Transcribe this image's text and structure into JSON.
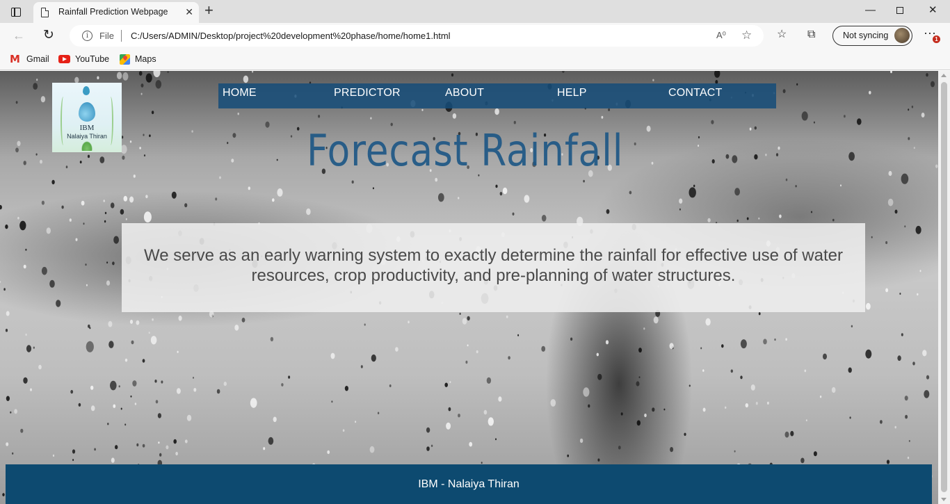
{
  "browser": {
    "tab_title": "Rainfall Prediction Webpage",
    "tab_close": "✕",
    "new_tab": "+",
    "scheme": "File",
    "url": "C:/Users/ADMIN/Desktop/project%20development%20phase/home/home1.html",
    "read_aloud": "A⁰",
    "profile_label": "Not syncing",
    "notification_count": "1",
    "bookmarks": [
      "Gmail",
      "YouTube",
      "Maps"
    ]
  },
  "site": {
    "logo_line1": "IBM",
    "logo_line2": "Nalaiya Thiran",
    "nav": [
      "HOME",
      "PREDICTOR",
      "ABOUT",
      "HELP",
      "CONTACT"
    ],
    "hero_title": "Forecast Rainfall",
    "info_text": "We serve as an early warning system to exactly determine the rainfall for effective use of water resources, crop productivity, and pre-planning of water structures.",
    "footer_text": "IBM - Nalaiya Thiran"
  },
  "colors": {
    "nav_bg": "#154c79",
    "hero_title": "#1c5685",
    "footer_bg": "#0d4a70",
    "info_box_bg": "#eeeeee"
  }
}
